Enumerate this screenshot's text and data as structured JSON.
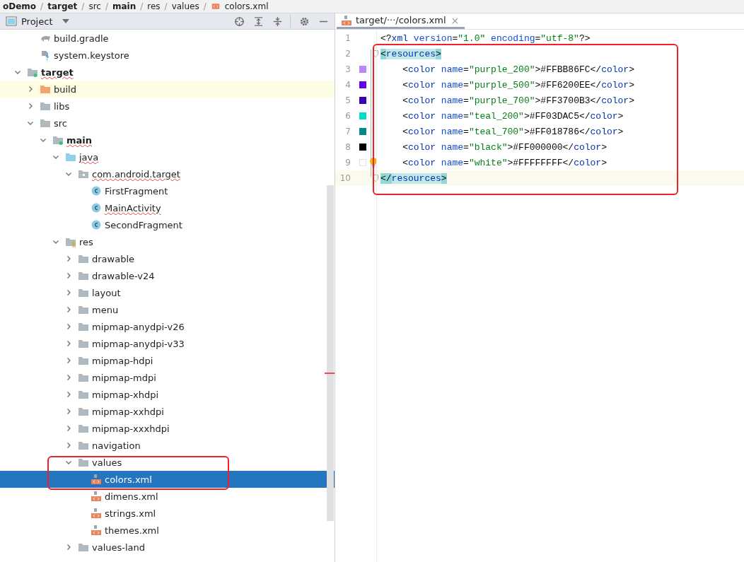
{
  "breadcrumb": [
    {
      "label": "oDemo",
      "bold": true,
      "file": false,
      "separator": "/"
    },
    {
      "label": "target",
      "bold": true,
      "file": false,
      "separator": "/"
    },
    {
      "label": "src",
      "bold": false,
      "file": false,
      "separator": "/"
    },
    {
      "label": "main",
      "bold": true,
      "file": false,
      "separator": "/"
    },
    {
      "label": "res",
      "bold": false,
      "file": false,
      "separator": "/"
    },
    {
      "label": "values",
      "bold": false,
      "file": false,
      "separator": "/"
    },
    {
      "label": "colors.xml",
      "bold": false,
      "file": true
    }
  ],
  "project_panel": {
    "title": "Project"
  },
  "tree": {
    "partial_items": [
      {
        "label": "build.gradle",
        "kind": "gradle",
        "selected": false,
        "highlighted": false,
        "underlined": false
      },
      {
        "label": "system.keystore",
        "kind": "keystore",
        "selected": false,
        "highlighted": false,
        "underlined": false
      }
    ],
    "items": [
      {
        "label": "target",
        "kind": "module",
        "bold": true,
        "expanded": true,
        "selected": false,
        "highlighted": false,
        "underlined": true,
        "children": [
          {
            "label": "build",
            "kind": "excluded",
            "bold": false,
            "expanded": false,
            "selected": false,
            "highlighted": true,
            "underlined": false
          },
          {
            "label": "libs",
            "kind": "folder",
            "bold": false,
            "expanded": false,
            "selected": false,
            "highlighted": false,
            "underlined": false
          },
          {
            "label": "src",
            "kind": "folder",
            "bold": false,
            "expanded": true,
            "selected": false,
            "highlighted": false,
            "underlined": false,
            "children": [
              {
                "label": "main",
                "kind": "module",
                "bold": true,
                "expanded": true,
                "selected": false,
                "highlighted": false,
                "underlined": true,
                "children": [
                  {
                    "label": "java",
                    "kind": "source",
                    "bold": false,
                    "expanded": true,
                    "selected": false,
                    "highlighted": false,
                    "underlined": true,
                    "children": [
                      {
                        "label": "com.android.target",
                        "kind": "package",
                        "bold": false,
                        "expanded": true,
                        "selected": false,
                        "highlighted": false,
                        "underlined": true,
                        "children": [
                          {
                            "label": "FirstFragment",
                            "kind": "class",
                            "selected": false,
                            "highlighted": false,
                            "underlined": false
                          },
                          {
                            "label": "MainActivity",
                            "kind": "class",
                            "selected": false,
                            "highlighted": false,
                            "underlined": true
                          },
                          {
                            "label": "SecondFragment",
                            "kind": "class",
                            "selected": false,
                            "highlighted": false,
                            "underlined": false
                          }
                        ]
                      }
                    ]
                  },
                  {
                    "label": "res",
                    "kind": "resources",
                    "bold": false,
                    "expanded": true,
                    "selected": false,
                    "highlighted": false,
                    "underlined": false,
                    "children": [
                      {
                        "label": "drawable",
                        "kind": "folder",
                        "bold": false,
                        "expanded": false,
                        "selected": false,
                        "highlighted": false,
                        "underlined": false
                      },
                      {
                        "label": "drawable-v24",
                        "kind": "folder",
                        "bold": false,
                        "expanded": false,
                        "selected": false,
                        "highlighted": false,
                        "underlined": false
                      },
                      {
                        "label": "layout",
                        "kind": "folder",
                        "bold": false,
                        "expanded": false,
                        "selected": false,
                        "highlighted": false,
                        "underlined": false
                      },
                      {
                        "label": "menu",
                        "kind": "folder",
                        "bold": false,
                        "expanded": false,
                        "selected": false,
                        "highlighted": false,
                        "underlined": false
                      },
                      {
                        "label": "mipmap-anydpi-v26",
                        "kind": "folder",
                        "bold": false,
                        "expanded": false,
                        "selected": false,
                        "highlighted": false,
                        "underlined": false
                      },
                      {
                        "label": "mipmap-anydpi-v33",
                        "kind": "folder",
                        "bold": false,
                        "expanded": false,
                        "selected": false,
                        "highlighted": false,
                        "underlined": false
                      },
                      {
                        "label": "mipmap-hdpi",
                        "kind": "folder",
                        "bold": false,
                        "expanded": false,
                        "selected": false,
                        "highlighted": false,
                        "underlined": false
                      },
                      {
                        "label": "mipmap-mdpi",
                        "kind": "folder",
                        "bold": false,
                        "expanded": false,
                        "selected": false,
                        "highlighted": false,
                        "underlined": false
                      },
                      {
                        "label": "mipmap-xhdpi",
                        "kind": "folder",
                        "bold": false,
                        "expanded": false,
                        "selected": false,
                        "highlighted": false,
                        "underlined": false
                      },
                      {
                        "label": "mipmap-xxhdpi",
                        "kind": "folder",
                        "bold": false,
                        "expanded": false,
                        "selected": false,
                        "highlighted": false,
                        "underlined": false
                      },
                      {
                        "label": "mipmap-xxxhdpi",
                        "kind": "folder",
                        "bold": false,
                        "expanded": false,
                        "selected": false,
                        "highlighted": false,
                        "underlined": false
                      },
                      {
                        "label": "navigation",
                        "kind": "folder",
                        "bold": false,
                        "expanded": false,
                        "selected": false,
                        "highlighted": false,
                        "underlined": false
                      },
                      {
                        "label": "values",
                        "kind": "folder",
                        "bold": false,
                        "expanded": true,
                        "selected": false,
                        "highlighted": false,
                        "underlined": false,
                        "children": [
                          {
                            "label": "colors.xml",
                            "kind": "xml",
                            "selected": true,
                            "highlighted": false,
                            "underlined": false
                          },
                          {
                            "label": "dimens.xml",
                            "kind": "xml",
                            "selected": false,
                            "highlighted": false,
                            "underlined": false
                          },
                          {
                            "label": "strings.xml",
                            "kind": "xml",
                            "selected": false,
                            "highlighted": false,
                            "underlined": false
                          },
                          {
                            "label": "themes.xml",
                            "kind": "xml",
                            "selected": false,
                            "highlighted": false,
                            "underlined": false
                          }
                        ]
                      },
                      {
                        "label": "values-land",
                        "kind": "folder",
                        "bold": false,
                        "expanded": false,
                        "selected": false,
                        "highlighted": false,
                        "underlined": false
                      }
                    ]
                  }
                ]
              }
            ]
          }
        ]
      }
    ]
  },
  "editor": {
    "tabs": [
      {
        "label": "target/···/colors.xml",
        "selected": true,
        "close": "×"
      }
    ],
    "lines": [
      {
        "number": "1",
        "current": false,
        "matched": false,
        "bulb": false,
        "text": "<?xml version=\"1.0\" encoding=\"utf-8\"?>"
      },
      {
        "number": "2",
        "current": false,
        "matched": true,
        "bulb": false,
        "text": "<resources>"
      },
      {
        "number": "3",
        "color": "#bb86fc",
        "current": false,
        "matched": false,
        "bulb": false,
        "text": "    <color name=\"purple_200\">#FFBB86FC</color>"
      },
      {
        "number": "4",
        "color": "#6200ee",
        "current": false,
        "matched": false,
        "bulb": false,
        "text": "    <color name=\"purple_500\">#FF6200EE</color>"
      },
      {
        "number": "5",
        "color": "#3700b3",
        "current": false,
        "matched": false,
        "bulb": false,
        "text": "    <color name=\"purple_700\">#FF3700B3</color>"
      },
      {
        "number": "6",
        "color": "#03dac5",
        "current": false,
        "matched": false,
        "bulb": false,
        "text": "    <color name=\"teal_200\">#FF03DAC5</color>"
      },
      {
        "number": "7",
        "color": "#018786",
        "current": false,
        "matched": false,
        "bulb": false,
        "text": "    <color name=\"teal_700\">#FF018786</color>"
      },
      {
        "number": "8",
        "color": "#000000",
        "current": false,
        "matched": false,
        "bulb": false,
        "text": "    <color name=\"black\">#FF000000</color>"
      },
      {
        "number": "9",
        "color": "#ffffff",
        "current": false,
        "matched": false,
        "bulb": true,
        "text": "    <color name=\"white\">#FFFFFFFF</color>"
      },
      {
        "number": "10",
        "current": true,
        "matched": true,
        "bulb": false,
        "text": "</resources>"
      }
    ]
  }
}
